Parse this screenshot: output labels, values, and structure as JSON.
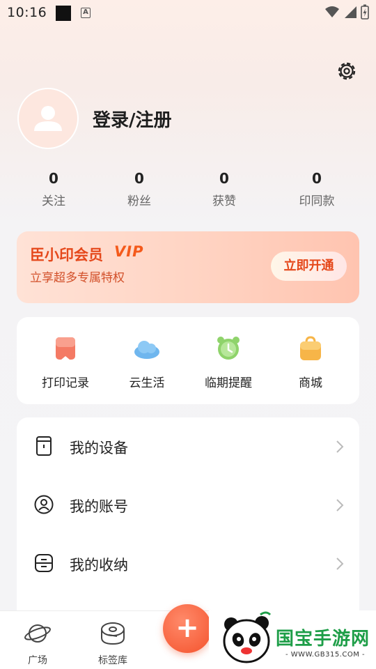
{
  "status_bar": {
    "time": "10:16",
    "notif_icon": "A"
  },
  "profile": {
    "login_label": "登录/注册"
  },
  "stats": [
    {
      "value": "0",
      "label": "关注"
    },
    {
      "value": "0",
      "label": "粉丝"
    },
    {
      "value": "0",
      "label": "获赞"
    },
    {
      "value": "0",
      "label": "印同款"
    }
  ],
  "vip": {
    "title": "臣小印会员",
    "badge": "VIP",
    "subtitle": "立享超多专属特权",
    "button": "立即开通"
  },
  "quick_actions": [
    {
      "label": "打印记录",
      "icon": "print-record-icon",
      "color": "#f47a64"
    },
    {
      "label": "云生活",
      "icon": "cloud-icon",
      "color": "#6fb6ee"
    },
    {
      "label": "临期提醒",
      "icon": "alarm-clock-icon",
      "color": "#8fd36b"
    },
    {
      "label": "商城",
      "icon": "shopping-bag-icon",
      "color": "#f7b548"
    }
  ],
  "menu": [
    {
      "label": "我的设备",
      "icon": "device-icon"
    },
    {
      "label": "我的账号",
      "icon": "account-icon"
    },
    {
      "label": "我的收纳",
      "icon": "storage-icon"
    }
  ],
  "bottom_nav": [
    {
      "label": "广场",
      "icon": "planet-icon"
    },
    {
      "label": "标签库",
      "icon": "tape-icon"
    }
  ],
  "watermark": {
    "text": "国宝手游网",
    "url": "- WWW.GB315.COM -"
  },
  "colors": {
    "accent": "#f4522c",
    "vip_text": "#e5481b"
  }
}
